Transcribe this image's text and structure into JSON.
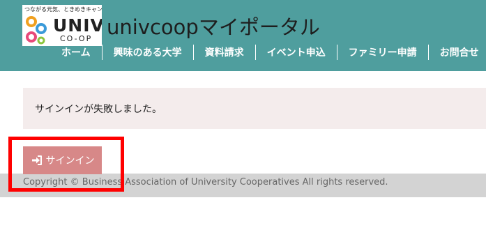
{
  "header": {
    "logo": {
      "tagline": "つながる元気、ときめきキャンパス。",
      "wordmark": "UNIV.",
      "sub": "CO-OP"
    },
    "site_title": "univcoopマイポータル"
  },
  "nav": {
    "items": [
      {
        "label": "ホーム"
      },
      {
        "label": "興味のある大学"
      },
      {
        "label": "資料請求"
      },
      {
        "label": "イベント申込"
      },
      {
        "label": "ファミリー申請"
      },
      {
        "label": "お問合せ"
      }
    ]
  },
  "alert": {
    "message": "サインインが失敗しました。"
  },
  "signin": {
    "label": "サインイン",
    "icon": "sign-in-icon"
  },
  "footer": {
    "copyright": "Copyright © Business Association of University Cooperatives All rights reserved."
  },
  "colors": {
    "header_bg": "#4f9e9e",
    "button_bg": "#d78888",
    "alert_bg": "#f4ecec",
    "footer_bg": "#d3d3d3",
    "highlight": "#ff0000"
  }
}
